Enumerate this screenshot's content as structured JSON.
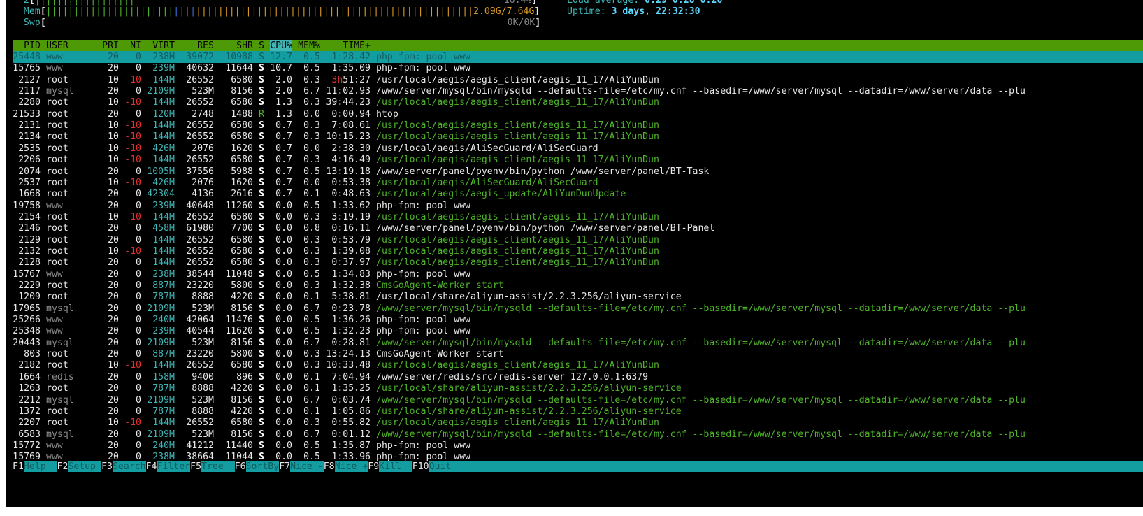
{
  "meters": {
    "cpu2": {
      "label": "2",
      "bar": "||||||||||||||||||",
      "value": "16.4%"
    },
    "mem": {
      "label": "Mem",
      "bar_green": "|||||||||||||||||||||||",
      "bar_blue": "||||",
      "bar_orange": "||||||||||||||||||||||||||||||||||||||||||||||||||",
      "value": "2.09G/7.64G"
    },
    "swp": {
      "label": "Swp",
      "value": "0K/0K"
    }
  },
  "info": {
    "load_label": "Load average:",
    "load_value": "0.29 0.28 0.26",
    "uptime_label": "Uptime:",
    "uptime_value": "3 days, 22:32:30"
  },
  "columns": {
    "pid": "PID",
    "user": "USER",
    "pri": "PRI",
    "ni": "NI",
    "virt": "VIRT",
    "res": "RES",
    "shr": "SHR",
    "s": "S",
    "cpu": "CPU%",
    "mem": "MEM%",
    "time": "TIME+",
    "command": "Command"
  },
  "processes": [
    {
      "pid": "25448",
      "user": "www",
      "pri": "20",
      "ni": "0",
      "virt": "238M",
      "res": "39072",
      "shr": "10988",
      "s": "S",
      "cpu": "12.7",
      "mem": "0.5",
      "time": "1:28.42",
      "cmd": "php-fpm: pool www"
    },
    {
      "pid": "15765",
      "user": "www",
      "pri": "20",
      "ni": "0",
      "virt": "239M",
      "res": "40632",
      "shr": "11644",
      "s": "S",
      "cpu": "10.7",
      "mem": "0.5",
      "time": "1:35.09",
      "cmd": "php-fpm: pool www"
    },
    {
      "pid": "2127",
      "user": "root",
      "pri": "10",
      "ni": "-10",
      "virt": "144M",
      "res": "26552",
      "shr": "6580",
      "s": "S",
      "cpu": "2.0",
      "mem": "0.3",
      "time": "3h51:27",
      "cmd": "/usr/local/aegis/aegis_client/aegis_11_17/AliYunDun"
    },
    {
      "pid": "2117",
      "user": "mysql",
      "pri": "20",
      "ni": "0",
      "virt": "2109M",
      "res": "523M",
      "shr": "8156",
      "s": "S",
      "cpu": "2.0",
      "mem": "6.7",
      "time": "11:02.93",
      "cmd": "/www/server/mysql/bin/mysqld --defaults-file=/etc/my.cnf --basedir=/www/server/mysql --datadir=/www/server/data --plu"
    },
    {
      "pid": "2280",
      "user": "root",
      "pri": "10",
      "ni": "-10",
      "virt": "144M",
      "res": "26552",
      "shr": "6580",
      "s": "S",
      "cpu": "1.3",
      "mem": "0.3",
      "time": "39:44.23",
      "cmd": "/usr/local/aegis/aegis_client/aegis_11_17/AliYunDun"
    },
    {
      "pid": "21533",
      "user": "root",
      "pri": "20",
      "ni": "0",
      "virt": "120M",
      "res": "2748",
      "shr": "1488",
      "s": "R",
      "cpu": "1.3",
      "mem": "0.0",
      "time": "0:00.94",
      "cmd": "htop"
    },
    {
      "pid": "2131",
      "user": "root",
      "pri": "10",
      "ni": "-10",
      "virt": "144M",
      "res": "26552",
      "shr": "6580",
      "s": "S",
      "cpu": "0.7",
      "mem": "0.3",
      "time": "7:08.61",
      "cmd": "/usr/local/aegis/aegis_client/aegis_11_17/AliYunDun"
    },
    {
      "pid": "2134",
      "user": "root",
      "pri": "10",
      "ni": "-10",
      "virt": "144M",
      "res": "26552",
      "shr": "6580",
      "s": "S",
      "cpu": "0.7",
      "mem": "0.3",
      "time": "10:15.23",
      "cmd": "/usr/local/aegis/aegis_client/aegis_11_17/AliYunDun"
    },
    {
      "pid": "2535",
      "user": "root",
      "pri": "10",
      "ni": "-10",
      "virt": "426M",
      "res": "2076",
      "shr": "1620",
      "s": "S",
      "cpu": "0.7",
      "mem": "0.0",
      "time": "2:38.30",
      "cmd": "/usr/local/aegis/AliSecGuard/AliSecGuard"
    },
    {
      "pid": "2206",
      "user": "root",
      "pri": "10",
      "ni": "-10",
      "virt": "144M",
      "res": "26552",
      "shr": "6580",
      "s": "S",
      "cpu": "0.7",
      "mem": "0.3",
      "time": "4:16.49",
      "cmd": "/usr/local/aegis/aegis_client/aegis_11_17/AliYunDun"
    },
    {
      "pid": "2074",
      "user": "root",
      "pri": "20",
      "ni": "0",
      "virt": "1005M",
      "res": "37556",
      "shr": "5988",
      "s": "S",
      "cpu": "0.7",
      "mem": "0.5",
      "time": "13:19.18",
      "cmd": "/www/server/panel/pyenv/bin/python /www/server/panel/BT-Task"
    },
    {
      "pid": "2537",
      "user": "root",
      "pri": "10",
      "ni": "-10",
      "virt": "426M",
      "res": "2076",
      "shr": "1620",
      "s": "S",
      "cpu": "0.7",
      "mem": "0.0",
      "time": "0:53.38",
      "cmd": "/usr/local/aegis/AliSecGuard/AliSecGuard"
    },
    {
      "pid": "1668",
      "user": "root",
      "pri": "20",
      "ni": "0",
      "virt": "42304",
      "res": "4136",
      "shr": "2616",
      "s": "S",
      "cpu": "0.7",
      "mem": "0.1",
      "time": "0:48.63",
      "cmd": "/usr/local/aegis/aegis_update/AliYunDunUpdate"
    },
    {
      "pid": "19758",
      "user": "www",
      "pri": "20",
      "ni": "0",
      "virt": "239M",
      "res": "40648",
      "shr": "11260",
      "s": "S",
      "cpu": "0.0",
      "mem": "0.5",
      "time": "1:33.62",
      "cmd": "php-fpm: pool www"
    },
    {
      "pid": "2154",
      "user": "root",
      "pri": "10",
      "ni": "-10",
      "virt": "144M",
      "res": "26552",
      "shr": "6580",
      "s": "S",
      "cpu": "0.0",
      "mem": "0.3",
      "time": "3:19.19",
      "cmd": "/usr/local/aegis/aegis_client/aegis_11_17/AliYunDun"
    },
    {
      "pid": "2146",
      "user": "root",
      "pri": "20",
      "ni": "0",
      "virt": "458M",
      "res": "61980",
      "shr": "7700",
      "s": "S",
      "cpu": "0.0",
      "mem": "0.8",
      "time": "0:16.11",
      "cmd": "/www/server/panel/pyenv/bin/python /www/server/panel/BT-Panel"
    },
    {
      "pid": "2129",
      "user": "root",
      "pri": "20",
      "ni": "0",
      "virt": "144M",
      "res": "26552",
      "shr": "6580",
      "s": "S",
      "cpu": "0.0",
      "mem": "0.3",
      "time": "0:53.79",
      "cmd": "/usr/local/aegis/aegis_client/aegis_11_17/AliYunDun"
    },
    {
      "pid": "2132",
      "user": "root",
      "pri": "10",
      "ni": "-10",
      "virt": "144M",
      "res": "26552",
      "shr": "6580",
      "s": "S",
      "cpu": "0.0",
      "mem": "0.3",
      "time": "1:39.08",
      "cmd": "/usr/local/aegis/aegis_client/aegis_11_17/AliYunDun"
    },
    {
      "pid": "2128",
      "user": "root",
      "pri": "20",
      "ni": "0",
      "virt": "144M",
      "res": "26552",
      "shr": "6580",
      "s": "S",
      "cpu": "0.0",
      "mem": "0.3",
      "time": "0:37.97",
      "cmd": "/usr/local/aegis/aegis_client/aegis_11_17/AliYunDun"
    },
    {
      "pid": "15767",
      "user": "www",
      "pri": "20",
      "ni": "0",
      "virt": "238M",
      "res": "38544",
      "shr": "11048",
      "s": "S",
      "cpu": "0.0",
      "mem": "0.5",
      "time": "1:34.83",
      "cmd": "php-fpm: pool www"
    },
    {
      "pid": "2229",
      "user": "root",
      "pri": "20",
      "ni": "0",
      "virt": "887M",
      "res": "23220",
      "shr": "5800",
      "s": "S",
      "cpu": "0.0",
      "mem": "0.3",
      "time": "1:32.38",
      "cmd": "CmsGoAgent-Worker start"
    },
    {
      "pid": "1209",
      "user": "root",
      "pri": "20",
      "ni": "0",
      "virt": "787M",
      "res": "8888",
      "shr": "4220",
      "s": "S",
      "cpu": "0.0",
      "mem": "0.1",
      "time": "5:38.81",
      "cmd": "/usr/local/share/aliyun-assist/2.2.3.256/aliyun-service"
    },
    {
      "pid": "17965",
      "user": "mysql",
      "pri": "20",
      "ni": "0",
      "virt": "2109M",
      "res": "523M",
      "shr": "8156",
      "s": "S",
      "cpu": "0.0",
      "mem": "6.7",
      "time": "0:23.78",
      "cmd": "/www/server/mysql/bin/mysqld --defaults-file=/etc/my.cnf --basedir=/www/server/mysql --datadir=/www/server/data --plu"
    },
    {
      "pid": "25266",
      "user": "www",
      "pri": "20",
      "ni": "0",
      "virt": "240M",
      "res": "42064",
      "shr": "11476",
      "s": "S",
      "cpu": "0.0",
      "mem": "0.5",
      "time": "1:36.26",
      "cmd": "php-fpm: pool www"
    },
    {
      "pid": "25348",
      "user": "www",
      "pri": "20",
      "ni": "0",
      "virt": "239M",
      "res": "40544",
      "shr": "11620",
      "s": "S",
      "cpu": "0.0",
      "mem": "0.5",
      "time": "1:32.23",
      "cmd": "php-fpm: pool www"
    },
    {
      "pid": "20443",
      "user": "mysql",
      "pri": "20",
      "ni": "0",
      "virt": "2109M",
      "res": "523M",
      "shr": "8156",
      "s": "S",
      "cpu": "0.0",
      "mem": "6.7",
      "time": "0:28.81",
      "cmd": "/www/server/mysql/bin/mysqld --defaults-file=/etc/my.cnf --basedir=/www/server/mysql --datadir=/www/server/data --plu"
    },
    {
      "pid": "803",
      "user": "root",
      "pri": "20",
      "ni": "0",
      "virt": "887M",
      "res": "23220",
      "shr": "5800",
      "s": "S",
      "cpu": "0.0",
      "mem": "0.3",
      "time": "13:24.13",
      "cmd": "CmsGoAgent-Worker start"
    },
    {
      "pid": "2182",
      "user": "root",
      "pri": "10",
      "ni": "-10",
      "virt": "144M",
      "res": "26552",
      "shr": "6580",
      "s": "S",
      "cpu": "0.0",
      "mem": "0.3",
      "time": "10:33.48",
      "cmd": "/usr/local/aegis/aegis_client/aegis_11_17/AliYunDun"
    },
    {
      "pid": "1664",
      "user": "redis",
      "pri": "20",
      "ni": "0",
      "virt": "158M",
      "res": "9400",
      "shr": "896",
      "s": "S",
      "cpu": "0.0",
      "mem": "0.1",
      "time": "7:04.94",
      "cmd": "/www/server/redis/src/redis-server 127.0.0.1:6379"
    },
    {
      "pid": "1263",
      "user": "root",
      "pri": "20",
      "ni": "0",
      "virt": "787M",
      "res": "8888",
      "shr": "4220",
      "s": "S",
      "cpu": "0.0",
      "mem": "0.1",
      "time": "1:35.25",
      "cmd": "/usr/local/share/aliyun-assist/2.2.3.256/aliyun-service"
    },
    {
      "pid": "2212",
      "user": "mysql",
      "pri": "20",
      "ni": "0",
      "virt": "2109M",
      "res": "523M",
      "shr": "8156",
      "s": "S",
      "cpu": "0.0",
      "mem": "6.7",
      "time": "0:03.74",
      "cmd": "/www/server/mysql/bin/mysqld --defaults-file=/etc/my.cnf --basedir=/www/server/mysql --datadir=/www/server/data --plu"
    },
    {
      "pid": "1372",
      "user": "root",
      "pri": "20",
      "ni": "0",
      "virt": "787M",
      "res": "8888",
      "shr": "4220",
      "s": "S",
      "cpu": "0.0",
      "mem": "0.1",
      "time": "1:05.86",
      "cmd": "/usr/local/share/aliyun-assist/2.2.3.256/aliyun-service"
    },
    {
      "pid": "2207",
      "user": "root",
      "pri": "10",
      "ni": "-10",
      "virt": "144M",
      "res": "26552",
      "shr": "6580",
      "s": "S",
      "cpu": "0.0",
      "mem": "0.3",
      "time": "0:55.82",
      "cmd": "/usr/local/aegis/aegis_client/aegis_11_17/AliYunDun"
    },
    {
      "pid": "6583",
      "user": "mysql",
      "pri": "20",
      "ni": "0",
      "virt": "2109M",
      "res": "523M",
      "shr": "8156",
      "s": "S",
      "cpu": "0.0",
      "mem": "6.7",
      "time": "0:01.12",
      "cmd": "/www/server/mysql/bin/mysqld --defaults-file=/etc/my.cnf --basedir=/www/server/mysql --datadir=/www/server/data --plu"
    },
    {
      "pid": "15772",
      "user": "www",
      "pri": "20",
      "ni": "0",
      "virt": "240M",
      "res": "41212",
      "shr": "11440",
      "s": "S",
      "cpu": "0.0",
      "mem": "0.5",
      "time": "1:35.87",
      "cmd": "php-fpm: pool www"
    },
    {
      "pid": "15769",
      "user": "www",
      "pri": "20",
      "ni": "0",
      "virt": "238M",
      "res": "38664",
      "shr": "11044",
      "s": "S",
      "cpu": "0.0",
      "mem": "0.5",
      "time": "1:33.96",
      "cmd": "php-fpm: pool www"
    }
  ],
  "footer": [
    {
      "key": "F1",
      "label": "Help  "
    },
    {
      "key": "F2",
      "label": "Setup "
    },
    {
      "key": "F3",
      "label": "Search"
    },
    {
      "key": "F4",
      "label": "Filter"
    },
    {
      "key": "F5",
      "label": "Tree  "
    },
    {
      "key": "F6",
      "label": "SortBy"
    },
    {
      "key": "F7",
      "label": "Nice -"
    },
    {
      "key": "F8",
      "label": "Nice +"
    },
    {
      "key": "F9",
      "label": "Kill  "
    },
    {
      "key": "F10",
      "label": "Quit"
    }
  ],
  "colors": {
    "header_bg": "#4e9a06",
    "selected_bg": "#149da1",
    "sort_col_bg": "#3fb5b5",
    "nice_neg": "#e03030",
    "thread_cmd": "#4eb52a"
  }
}
